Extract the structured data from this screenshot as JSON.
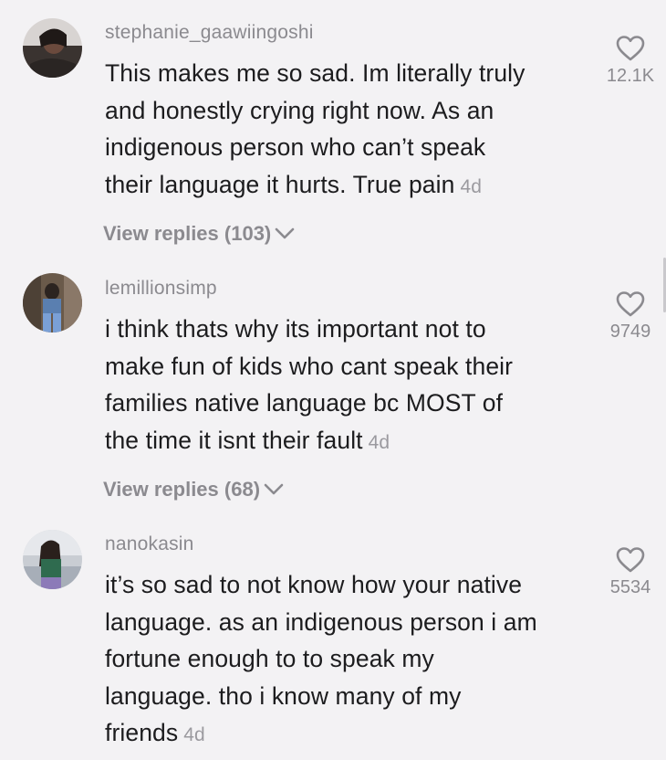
{
  "comments": [
    {
      "username": "stephanie_gaawiingoshi",
      "lines": [
        "This makes me so sad. Im literally truly",
        "and honestly crying right now. As an",
        "indigenous person who can’t speak",
        "their language it hurts. True pain"
      ],
      "time": "4d",
      "likes": "12.1K",
      "replies_label": "View replies (103)"
    },
    {
      "username": "lemillionsimp",
      "lines": [
        "i think thats why its important not to",
        "make fun of kids who cant speak their",
        "families native language bc MOST of",
        "the time it isnt their fault"
      ],
      "time": "4d",
      "likes": "9749",
      "replies_label": "View replies (68)"
    },
    {
      "username": "nanokasin",
      "lines": [
        "it’s so sad to not know how your native",
        "language. as an indigenous person i am",
        "fortune enough to to speak my",
        "language. tho i know many of my",
        "friends"
      ],
      "time": "4d",
      "likes": "5534"
    }
  ],
  "icons": {
    "like": "heart-outline-icon",
    "expand": "chevron-down-icon"
  },
  "colors": {
    "background": "#f3f2f4",
    "text": "#1c1c1e",
    "muted": "#8b8a8f"
  }
}
